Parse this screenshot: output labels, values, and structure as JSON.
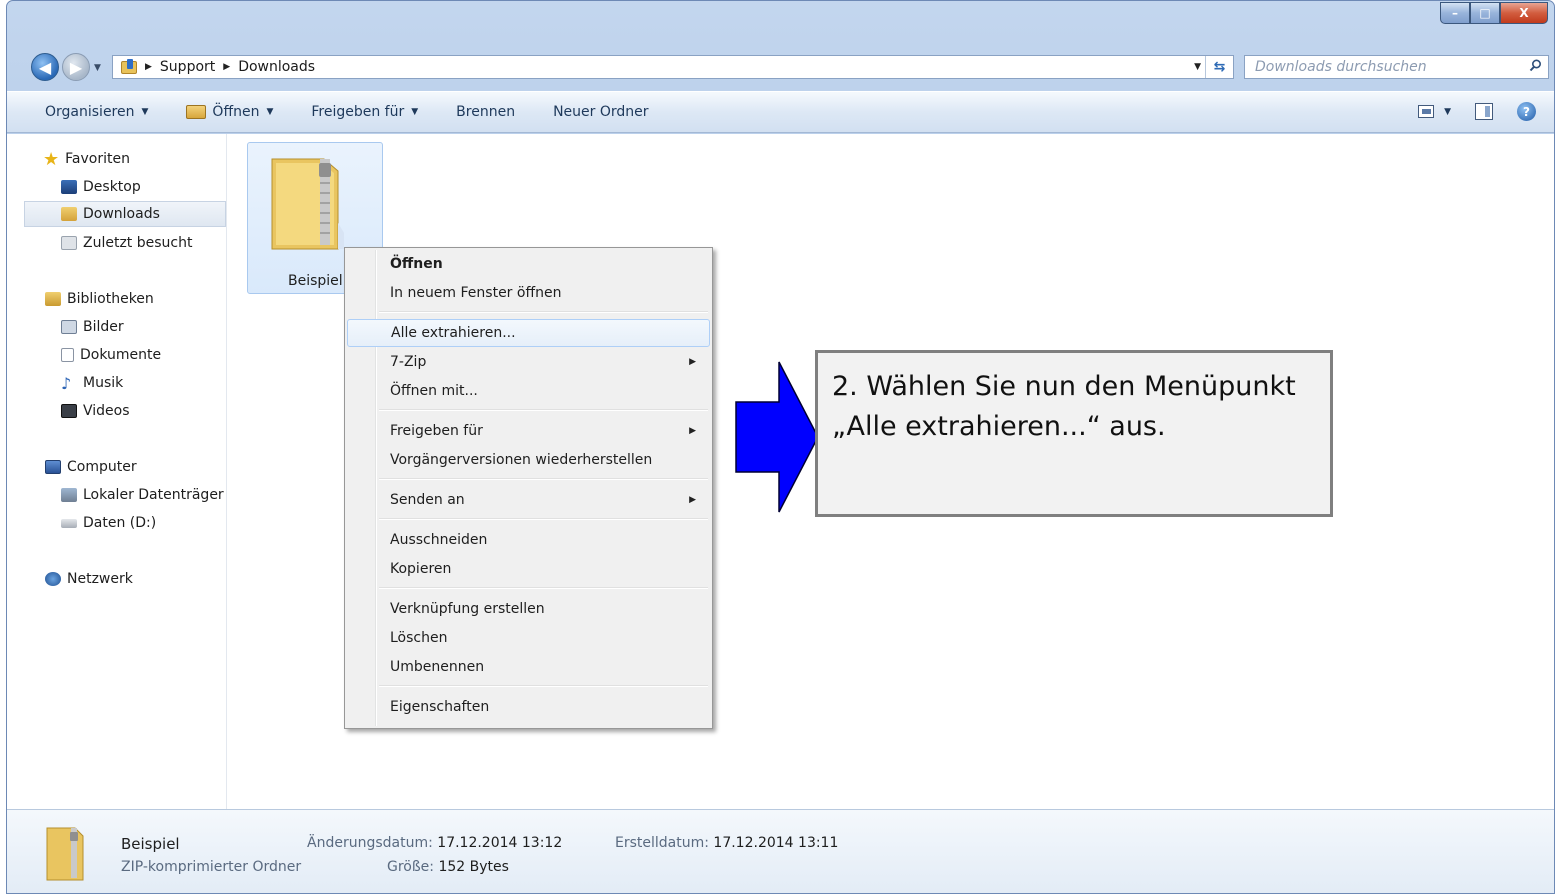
{
  "window": {
    "caption_buttons": {
      "minimize": "–",
      "maximize": "□",
      "close": "X"
    }
  },
  "nav": {
    "back_icon": "back-arrow-icon",
    "forward_icon": "forward-arrow-icon",
    "breadcrumb": [
      "Support",
      "Downloads"
    ],
    "search_placeholder": "Downloads durchsuchen"
  },
  "toolbar": {
    "organize": "Organisieren",
    "open": "Öffnen",
    "share": "Freigeben für",
    "burn": "Brennen",
    "new_folder": "Neuer Ordner"
  },
  "sidebar": {
    "favorites": {
      "label": "Favoriten",
      "items": [
        "Desktop",
        "Downloads",
        "Zuletzt besucht"
      ]
    },
    "libraries": {
      "label": "Bibliotheken",
      "items": [
        "Bilder",
        "Dokumente",
        "Musik",
        "Videos"
      ]
    },
    "computer": {
      "label": "Computer",
      "items": [
        "Lokaler Datenträger",
        "Daten (D:)"
      ]
    },
    "network": {
      "label": "Netzwerk"
    },
    "selected": "Downloads"
  },
  "file": {
    "name": "Beispiel"
  },
  "context_menu": {
    "items": [
      "Öffnen",
      "In neuem Fenster öffnen",
      "Alle extrahieren...",
      "7-Zip",
      "Öffnen mit...",
      "Freigeben für",
      "Vorgängerversionen wiederherstellen",
      "Senden an",
      "Ausschneiden",
      "Kopieren",
      "Verknüpfung erstellen",
      "Löschen",
      "Umbenennen",
      "Eigenschaften"
    ],
    "highlighted": "Alle extrahieren..."
  },
  "status": {
    "name": "Beispiel",
    "type": "ZIP-komprimierter Ordner",
    "modified_label": "Änderungsdatum:",
    "modified_value": "17.12.2014 13:12",
    "created_label": "Erstelldatum:",
    "created_value": "17.12.2014 13:11",
    "size_label": "Größe:",
    "size_value": "152 Bytes"
  },
  "callout": {
    "text": "2. Wählen Sie nun den Menüpunkt „Alle extrahieren...“ aus.",
    "arrow_color": "#0000ff"
  }
}
